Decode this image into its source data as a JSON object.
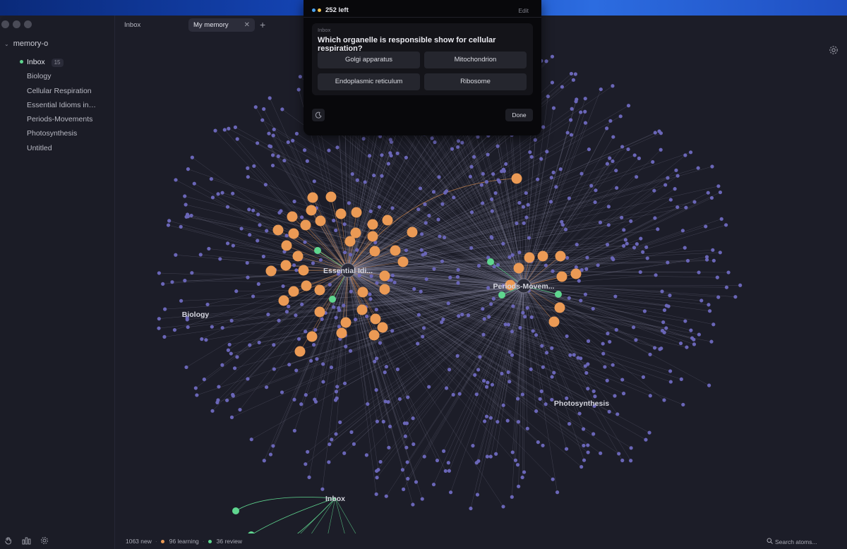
{
  "window": {
    "tabs": [
      {
        "label": "Inbox",
        "active": false
      },
      {
        "label": "My memory",
        "active": true
      }
    ],
    "new_tab_label": "+",
    "close_label": "✕"
  },
  "sidebar": {
    "root": "memory-o",
    "items": [
      {
        "label": "Inbox",
        "count": "15",
        "active": true
      },
      {
        "label": "Biology"
      },
      {
        "label": "Cellular Respiration"
      },
      {
        "label": "Essential Idioms in E..."
      },
      {
        "label": "Periods-Movements"
      },
      {
        "label": "Photosynthesis"
      },
      {
        "label": "Untitled"
      }
    ]
  },
  "graph": {
    "hub_labels": {
      "essential": "Essential Idi...",
      "periods": "Periods-Movem...",
      "biology": "Biology",
      "photosynthesis": "Photosynthesis",
      "inbox": "Inbox"
    },
    "colors": {
      "new": "#6a66b8",
      "learning": "#eb9a55",
      "review": "#5fd68f",
      "edge": "#8f8fa8",
      "background": "#1d1e29"
    }
  },
  "status": {
    "new": "1063 new",
    "learning": "96 learning",
    "review": "36 review",
    "separator": "·"
  },
  "search": {
    "placeholder": "Search atoms..."
  },
  "quiz": {
    "remaining": "252 left",
    "edit_label": "Edit",
    "source": "Inbox",
    "question": "Which organelle is responsible show for cellular respiration?",
    "answers": [
      "Golgi apparatus",
      "Mitochondrion",
      "Endoplasmic reticulum",
      "Ribosome"
    ],
    "done_label": "Done",
    "dot_colors": [
      "#4aa3f0",
      "#f3c24d"
    ]
  },
  "icons": {
    "settings": "gear-icon",
    "theme": "moon-icon",
    "search": "search-icon",
    "hand": "hand-icon",
    "stats": "bar-chart-icon"
  }
}
